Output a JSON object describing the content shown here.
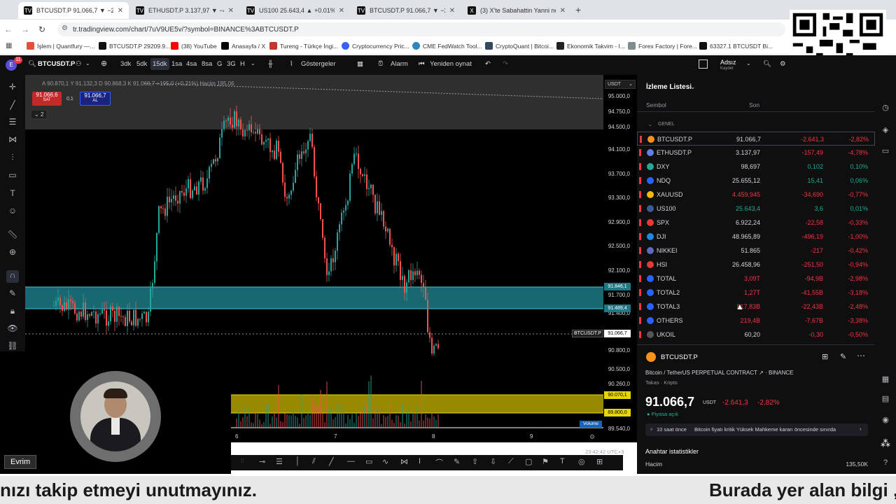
{
  "browser": {
    "tabs": [
      {
        "title": "BTCUSDT.P 91.066,7 ▼ −2.82%",
        "active": true
      },
      {
        "title": "ETHUSDT.P 3.137,97 ▼ −4.78%",
        "active": false
      },
      {
        "title": "US100 25.643,4 ▲ +0.01% Adsı",
        "active": false
      },
      {
        "title": "BTCUSDT.P 91.066,7 ▼ −2.82%",
        "active": false
      },
      {
        "title": "(3) X'te Sabahattin Yanni nokta",
        "active": false
      }
    ],
    "new_tab": "+",
    "url": "tr.tradingview.com/chart/7uV9UE5v/?symbol=BINANCE%3ABTCUSDT.P",
    "bookmarks": [
      "İşlem | Quantfury —...",
      "BTCUSDT.P 29209.9...",
      "(38) YouTube",
      "Anasayfa / X",
      "Tureng - Türkçe İngi...",
      "Cryptocurrency Pric...",
      "CME FedWatch Tool...",
      "CryptoQuant | Bitcoi...",
      "Ekonomik Takvim - I...",
      "Forex Factory | Fore...",
      "63327.1 BTCUSDT Bi..."
    ]
  },
  "toolbar": {
    "avatar_badge": "11",
    "symbol": "BTCUSDT.P",
    "intervals": [
      "3dk",
      "5dk",
      "15dk",
      "1sa",
      "4sa",
      "8sa",
      "G",
      "3G",
      "H"
    ],
    "active_interval": "15dk",
    "indicators": "Göstergeler",
    "alarm": "Alarm",
    "replay": "Yeniden oynat",
    "user": "Adsız",
    "user_sub": "Kaydet"
  },
  "chart": {
    "legend": "A 90.870,1  Y 91.132,3  D 90.868,3  K 91.066,7  +195,0 (+0.21%)   Hacim  195,06",
    "sell_price": "91.066,6",
    "sell_label": "SAT",
    "spread": "0,1",
    "buy_price": "91.066,7",
    "buy_label": "AL",
    "collapse_count": "2",
    "currency": "USDT",
    "price_labels": [
      "95.000,0",
      "94.750,0",
      "94.500,0",
      "94.100,0",
      "93.700,0",
      "93.300,0",
      "92.900,0",
      "92.500,0",
      "92.100,0",
      "91.700,0",
      "91.400,0",
      "90.800,0",
      "90.500,0",
      "90.260,0",
      "89.540,0"
    ],
    "zone_top_label": "91.846,1",
    "zone_bottom_label": "91.489,4",
    "current_symbol_tag": "BTCUSDT.P",
    "current_price_tag": "91.066,7",
    "yellow_top_label": "90.070,1",
    "yellow_bottom_label": "89.800,0",
    "volume_tag": "Volume",
    "x_labels": [
      "6",
      "7",
      "8",
      "9"
    ],
    "clock": "23:42:42 UTC+3"
  },
  "watchlist": {
    "title": "İzleme Listesi",
    "col_symbol": "Sembol",
    "col_last": "Son",
    "group": "GENEL",
    "rows": [
      {
        "sym": "BTCUSDT.P",
        "last": "91.066,7",
        "chg": "-2.641,3",
        "pct": "-2,82%",
        "color": "#f7931a",
        "neg": true
      },
      {
        "sym": "ETHUSDT.P",
        "last": "3.137,97",
        "chg": "-157,49",
        "pct": "-4,78%",
        "color": "#627eea",
        "neg": true
      },
      {
        "sym": "DXY",
        "last": "98,697",
        "chg": "0,102",
        "pct": "0,10%",
        "color": "#26a69a",
        "neg": false
      },
      {
        "sym": "NDQ",
        "last": "25.655,12",
        "chg": "15,41",
        "pct": "0,06%",
        "color": "#2962ff",
        "neg": false
      },
      {
        "sym": "XAUUSD",
        "last": "4.459,945",
        "chg": "-34,690",
        "pct": "-0,77%",
        "color": "#f0b90b",
        "neg": true
      },
      {
        "sym": "US100",
        "last": "25.643,4",
        "chg": "3,6",
        "pct": "0,01%",
        "color": "#3c5a99",
        "neg": false
      },
      {
        "sym": "SPX",
        "last": "6.922,24",
        "chg": "-22,58",
        "pct": "-0,33%",
        "color": "#e53935",
        "neg": true
      },
      {
        "sym": "DJI",
        "last": "48.965,89",
        "chg": "-496,19",
        "pct": "-1,00%",
        "color": "#1e88e5",
        "neg": true
      },
      {
        "sym": "NIKKEI",
        "last": "51.865",
        "chg": "-217",
        "pct": "-0,42%",
        "color": "#5c6bc0",
        "neg": true
      },
      {
        "sym": "HSI",
        "last": "26.458,96",
        "chg": "-251,50",
        "pct": "-0,94%",
        "color": "#e53935",
        "neg": true
      },
      {
        "sym": "TOTAL",
        "last": "3,09T",
        "chg": "-94,9B",
        "pct": "-2,98%",
        "color": "#2962ff",
        "neg": true
      },
      {
        "sym": "TOTAL2",
        "last": "1,27T",
        "chg": "-41,55B",
        "pct": "-3,18%",
        "color": "#2962ff",
        "neg": true
      },
      {
        "sym": "TOTAL3",
        "last": "817,83B",
        "chg": "-22,43B",
        "pct": "-2,48%",
        "color": "#2962ff",
        "neg": true
      },
      {
        "sym": "OTHERS",
        "last": "219,4B",
        "chg": "-7,67B",
        "pct": "-3,38%",
        "color": "#2962ff",
        "neg": true
      },
      {
        "sym": "UKOIL",
        "last": "60,20",
        "chg": "-0,30",
        "pct": "-0,50%",
        "color": "#555555",
        "neg": true
      }
    ],
    "detail": {
      "symbol": "BTCUSDT.P",
      "desc": "Bitcoin / TetherUS PERPETUAL CONTRACT",
      "exchange": "BINANCE",
      "type": "Takas · Kripto",
      "price": "91.066,7",
      "currency": "USDT",
      "change": "-2.641,3",
      "pct": "-2,82%",
      "market": "Piyasa açık",
      "news_time": "10 saat önce",
      "news": "Bitcoin fiyatı kritik Yüksek Mahkeme kararı öncesinde sınırda",
      "stats_title": "Anahtar istatistikler",
      "volume_label": "Hacim",
      "volume_value": "135,50K"
    }
  },
  "webcam": {
    "name": "Evrim"
  },
  "subtitle": {
    "left": "nızı takip etmeyi unutmayınız.",
    "right": "Burada yer alan bilgi , y"
  },
  "colors": {
    "zone": "#1c7a85",
    "yellow_zone": "#c9b800",
    "negative": "#f23645",
    "positive": "#22ab94"
  }
}
